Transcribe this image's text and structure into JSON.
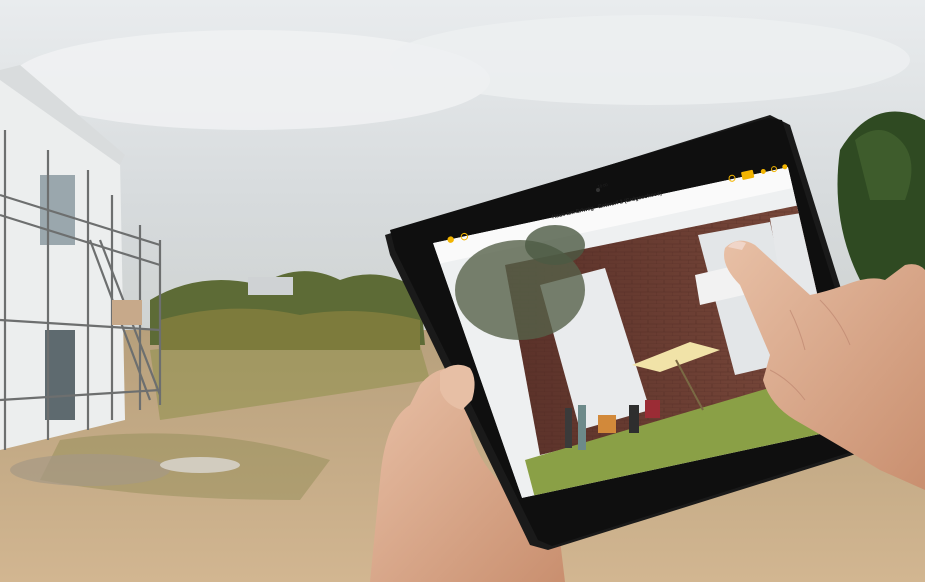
{
  "tablet": {
    "status_time": "10:00",
    "app_title": "Haus am Erlweg - Entwurf 2 (Erdgeschoss)",
    "accent_color": "#f2b400"
  },
  "icons": [
    "back-icon",
    "undo-icon",
    "redo-icon",
    "sun-icon",
    "layers-icon",
    "settings-icon",
    "more-icon"
  ],
  "colors": {
    "sky": "#dfe3e6",
    "ground": "#c7ab87",
    "brick": "#6b3d32",
    "lawn": "#8da24c",
    "tablet_frame": "#151515"
  }
}
